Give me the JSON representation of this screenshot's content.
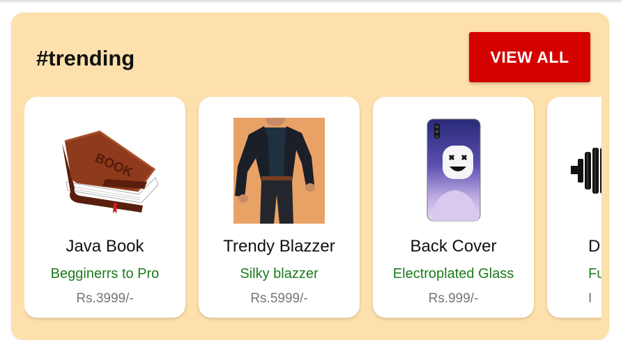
{
  "section": {
    "title": "#trending",
    "view_all_label": "VIEW ALL"
  },
  "products": [
    {
      "name": "Java Book",
      "subtitle": "Begginerrs to Pro",
      "price": "Rs.3999/-",
      "image": "book-icon"
    },
    {
      "name": "Trendy Blazzer",
      "subtitle": "Silky blazzer",
      "price": "Rs.5999/-",
      "image": "blazer-photo"
    },
    {
      "name": "Back Cover",
      "subtitle": "Electroplated Glass",
      "price": "Rs.999/-",
      "image": "phone-cover-photo"
    },
    {
      "name": "Du",
      "subtitle": "Fu",
      "price": "I",
      "image": "dumbbell-icon"
    }
  ],
  "colors": {
    "section_bg": "#fee0ac",
    "button_bg": "#d50000",
    "subtitle_text": "#1b7a1b",
    "price_text": "#757575"
  }
}
